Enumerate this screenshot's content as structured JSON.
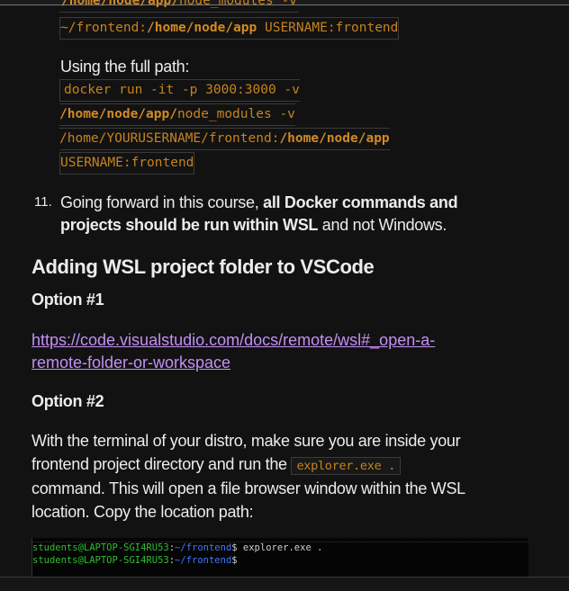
{
  "code_prev": {
    "line1_bold": "/home/node/app/",
    "line1_rest": "node_modules -v",
    "line2_a": "~/frontend:",
    "line2_bold": "/home/node/app",
    "line2_c": " USERNAME:frontend"
  },
  "full_path_label": "Using the full path:",
  "code_full": {
    "l1": "docker run -it -p 3000:3000 -v",
    "l2_bold": "/home/node/app/",
    "l2_rest": "node_modules -v",
    "l3_a": "/home/YOURUSERNAME/frontend:",
    "l3_bold": "/home/node/app",
    "l4": "USERNAME:frontend"
  },
  "step11": {
    "number": "11.",
    "text_a": "Going forward in this course, ",
    "bold_a": "all Docker commands and",
    "bold_b": "projects should be run within WSL",
    "text_b": " and not Windows."
  },
  "heading": "Adding WSL project folder to VSCode",
  "option1": {
    "title": "Option #1",
    "link_line1": "https://code.visualstudio.com/docs/remote/wsl#_open-a-",
    "link_line2": "remote-folder-or-workspace"
  },
  "option2": {
    "title": "Option #2",
    "p1": "With the terminal of your distro, make sure you are inside your",
    "p2a": "frontend project directory and run the ",
    "p2code": "explorer.exe .",
    "p3": "command. This will open a file browser window within the WSL",
    "p4": "location. Copy the location path:"
  },
  "terminal": {
    "prompt_user": "students@LAPTOP-SGI4RU53",
    "sep": ":",
    "path": "~/frontend",
    "dollar": "$",
    "cmd": " explorer.exe ."
  }
}
